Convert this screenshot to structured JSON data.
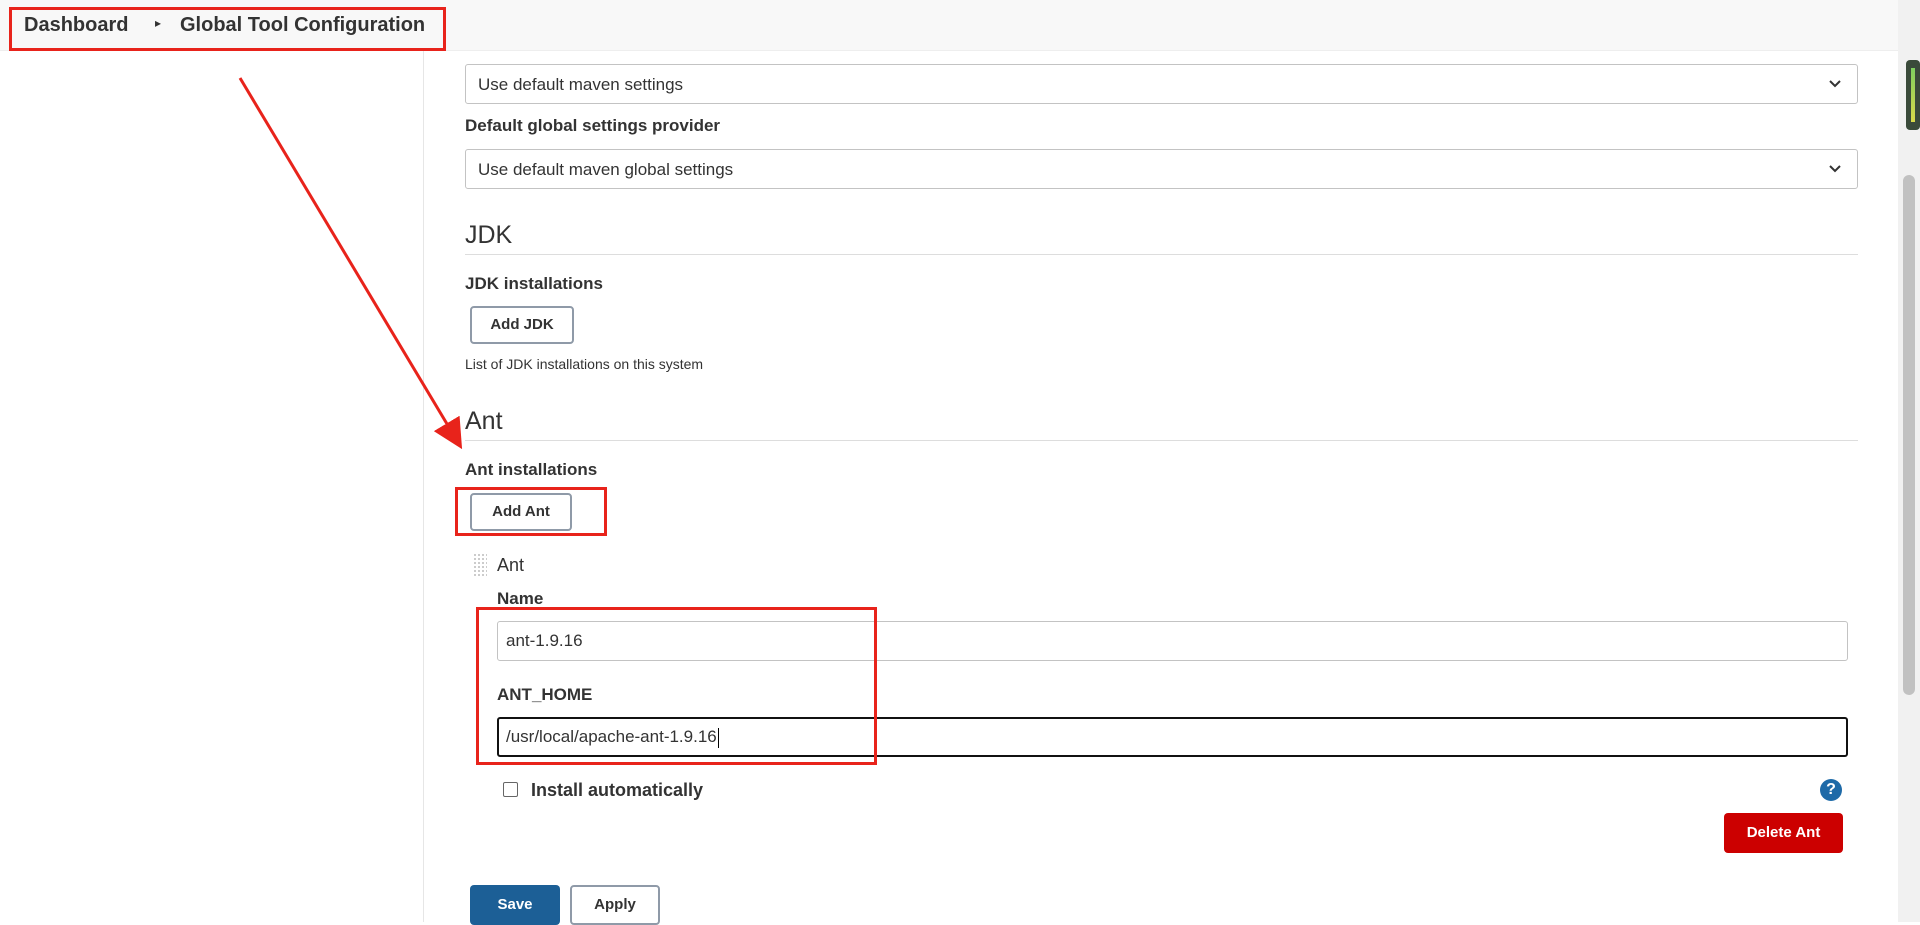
{
  "breadcrumb": {
    "items": [
      "Dashboard",
      "Global Tool Configuration"
    ],
    "separator": "›"
  },
  "maven": {
    "settings_provider_value": "Use default maven settings",
    "global_settings_label": "Default global settings provider",
    "global_settings_provider_value": "Use default maven global settings"
  },
  "jdk": {
    "section_title": "JDK",
    "installations_label": "JDK installations",
    "add_button": "Add JDK",
    "hint": "List of JDK installations on this system"
  },
  "ant": {
    "section_title": "Ant",
    "installations_label": "Ant installations",
    "add_button": "Add Ant",
    "installation": {
      "title": "Ant",
      "name_label": "Name",
      "name_value": "ant-1.9.16",
      "home_label": "ANT_HOME",
      "home_value": "/usr/local/apache-ant-1.9.16",
      "install_automatically_label": "Install automatically",
      "install_automatically_checked": false,
      "help_icon": "?",
      "delete_button": "Delete Ant"
    }
  },
  "footer": {
    "save_button": "Save",
    "apply_button": "Apply"
  },
  "colors": {
    "annotation": "#e8231b",
    "primary": "#1c5f96",
    "danger": "#cc0000",
    "help": "#1e6aa8"
  }
}
